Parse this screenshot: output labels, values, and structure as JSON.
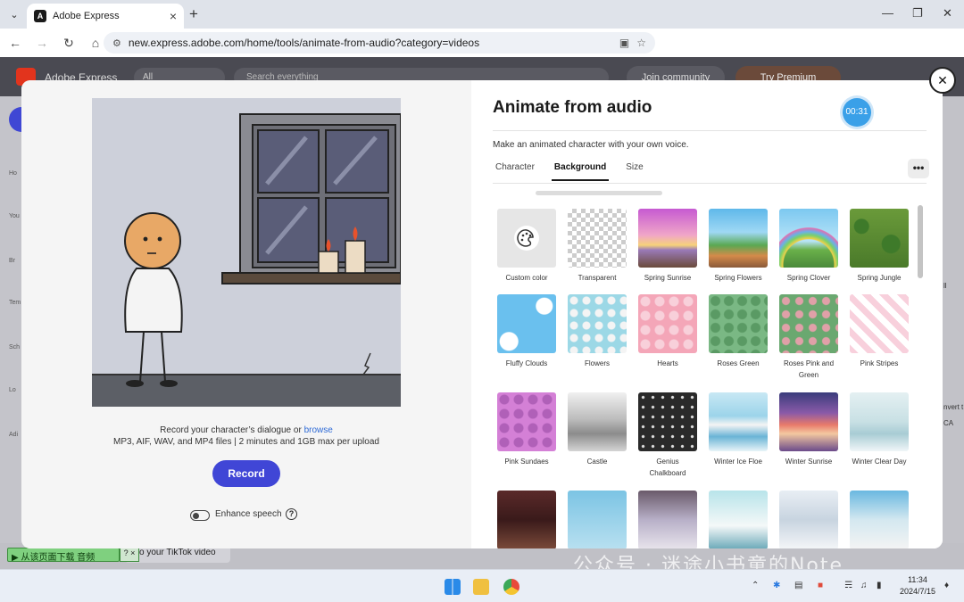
{
  "browser": {
    "tab_title": "Adobe Express",
    "favicon_letter": "A",
    "url": "new.express.adobe.com/home/tools/animate-from-audio?category=videos"
  },
  "express_header": {
    "brand": "Adobe Express",
    "search_scope": "All",
    "search_placeholder": "Search everything",
    "join_label": "Join community",
    "premium_label": "Try Premium"
  },
  "sidebar_labels": [
    "Ho",
    "You",
    "Br",
    "Tem",
    "Sch",
    "Lo",
    "Adi"
  ],
  "right_labels": [
    "ll",
    "nvert t",
    "CA"
  ],
  "background_page": {
    "tiktok_text": "o your TikTok video",
    "overlay_text": "从该页面下载 音频",
    "overlay_help": "?",
    "watermark": "公众号 · 迷途小书童的Note"
  },
  "modal": {
    "title": "Animate from audio",
    "timer": "00:31",
    "subtitle": "Make an animated character with your own voice.",
    "tabs": [
      "Character",
      "Background",
      "Size"
    ],
    "active_tab": "Background",
    "more_label": "•••",
    "record_line1": "Record your character’s dialogue or",
    "browse_label": "browse",
    "record_line2": "MP3, AIF, WAV, and MP4 files | 2 minutes and 1GB max per upload",
    "record_button": "Record",
    "enhance_label": "Enhance speech",
    "help_label": "?"
  },
  "backgrounds": [
    {
      "label": "Custom color",
      "icon": "palette-icon"
    },
    {
      "label": "Transparent"
    },
    {
      "label": "Spring Sunrise"
    },
    {
      "label": "Spring Flowers"
    },
    {
      "label": "Spring Clover"
    },
    {
      "label": "Spring Jungle"
    },
    {
      "label": "Fluffy Clouds"
    },
    {
      "label": "Flowers"
    },
    {
      "label": "Hearts"
    },
    {
      "label": "Roses Green"
    },
    {
      "label": "Roses Pink and Green"
    },
    {
      "label": "Pink Stripes"
    },
    {
      "label": "Pink Sundaes"
    },
    {
      "label": "Castle"
    },
    {
      "label": "Genius Chalkboard"
    },
    {
      "label": "Winter Ice Floe"
    },
    {
      "label": "Winter Sunrise"
    },
    {
      "label": "Winter Clear Day"
    }
  ],
  "taskbar": {
    "time": "11:34",
    "date": "2024/7/15"
  },
  "colors": {
    "accent": "#4046d6",
    "timer": "#3aa0e8",
    "link": "#2e6ad6"
  }
}
